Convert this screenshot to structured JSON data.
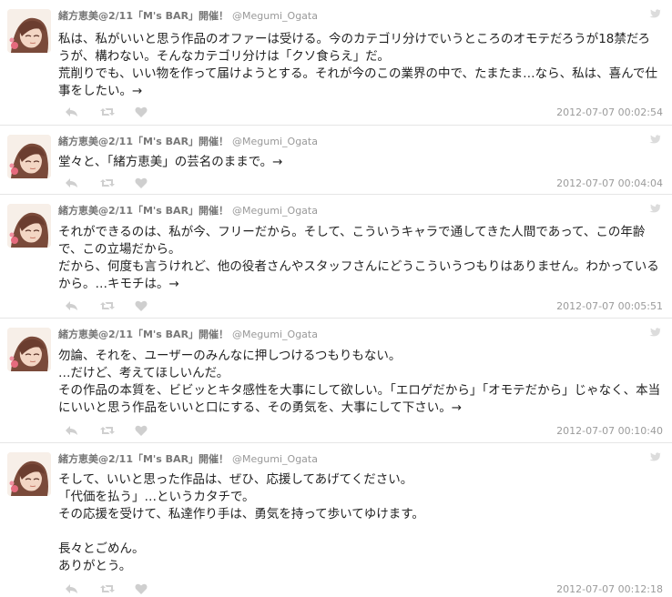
{
  "author": {
    "name": "緒方恵美@2/11「M's BAR」開催！",
    "handle": "@Megumi_Ogata"
  },
  "icons": {
    "reply": "reply-icon",
    "retweet": "retweet-icon",
    "favorite": "heart-icon",
    "platform": "bird-icon"
  },
  "colors": {
    "action_icon": "#cfcfcf",
    "bird": "#dcdcdc",
    "timestamp": "#9b9b9b"
  },
  "tweets": [
    {
      "text": "私は、私がいいと思う作品のオファーは受ける。今のカテゴリ分けでいうところのオモテだろうが18禁だろうが、構わない。そんなカテゴリ分けは「クソ食らえ」だ。\n荒削りでも、いい物を作って届けようとする。それが今のこの業界の中で、たまたま…なら、私は、喜んで仕事をしたい。→",
      "timestamp": "2012-07-07 00:02:54"
    },
    {
      "text": "堂々と、「緒方恵美」の芸名のままで。→",
      "timestamp": "2012-07-07 00:04:04"
    },
    {
      "text": "それができるのは、私が今、フリーだから。そして、こういうキャラで通してきた人間であって、この年齢で、この立場だから。\nだから、何度も言うけれど、他の役者さんやスタッフさんにどうこういうつもりはありません。わかっているから。…キモチは。→",
      "timestamp": "2012-07-07 00:05:51"
    },
    {
      "text": "勿論、それを、ユーザーのみんなに押しつけるつもりもない。\n…だけど、考えてほしいんだ。\nその作品の本質を、ビビッとキタ感性を大事にして欲しい。「エロゲだから」「オモテだから」じゃなく、本当にいいと思う作品をいいと口にする、その勇気を、大事にして下さい。→",
      "timestamp": "2012-07-07 00:10:40"
    },
    {
      "text": "そして、いいと思った作品は、ぜひ、応援してあげてください。\n「代価を払う」…というカタチで。\nその応援を受けて、私達作り手は、勇気を持って歩いてゆけます。\n\n長々とごめん。\nありがとう。",
      "timestamp": "2012-07-07 00:12:18"
    }
  ]
}
